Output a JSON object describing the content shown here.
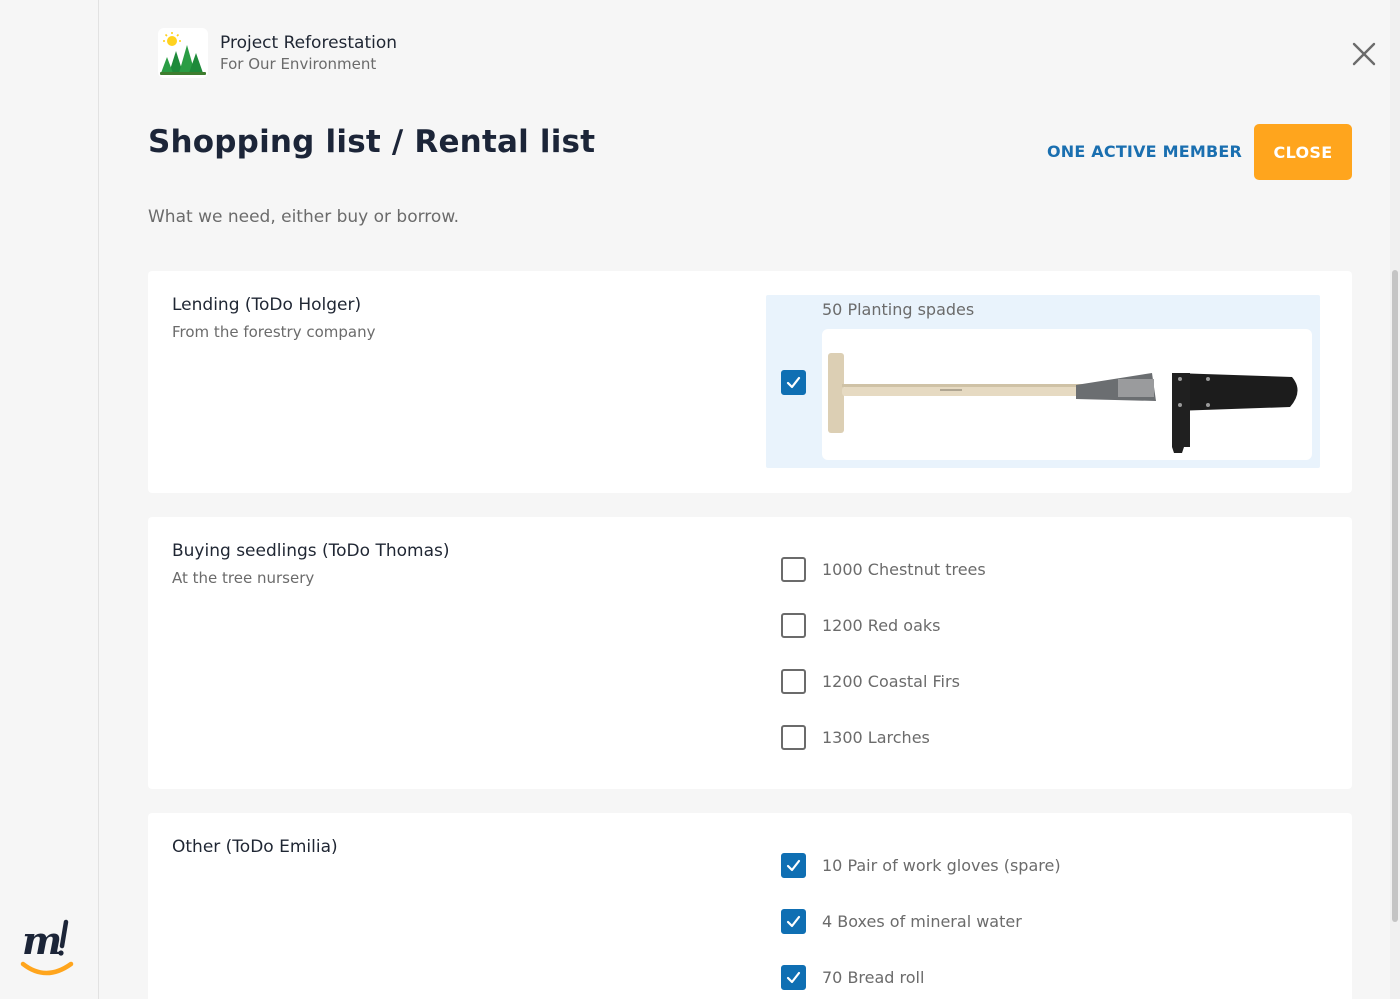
{
  "project": {
    "name": "Project Reforestation",
    "tagline": "For Our Environment"
  },
  "page": {
    "title": "Shopping list / Rental list",
    "subtitle": "What we need, either buy or borrow."
  },
  "header": {
    "members_label": "ONE ACTIVE MEMBER",
    "close_label": "CLOSE"
  },
  "sections": [
    {
      "title": "Lending (ToDo Holger)",
      "description": "From the forestry company",
      "items": [
        {
          "label": "50 Planting spades",
          "checked": true,
          "image": "planting-spade-image"
        }
      ]
    },
    {
      "title": "Buying seedlings (ToDo Thomas)",
      "description": "At the tree nursery",
      "items": [
        {
          "label": "1000 Chestnut trees",
          "checked": false
        },
        {
          "label": "1200 Red oaks",
          "checked": false
        },
        {
          "label": "1200 Coastal Firs",
          "checked": false
        },
        {
          "label": "1300 Larches",
          "checked": false
        }
      ]
    },
    {
      "title": "Other (ToDo Emilia)",
      "description": "",
      "items": [
        {
          "label": "10 Pair of work gloves (spare)",
          "checked": true
        },
        {
          "label": "4 Boxes of mineral water",
          "checked": true
        },
        {
          "label": "70 Bread roll",
          "checked": true
        }
      ]
    }
  ],
  "colors": {
    "accent": "#ffa51d",
    "link": "#1a6fb0",
    "checkbox": "#0f6fb3",
    "highlight": "#e9f3fc"
  },
  "icons": {
    "close": "close-icon",
    "check": "checkmark-icon",
    "brand": "brand-logo"
  }
}
